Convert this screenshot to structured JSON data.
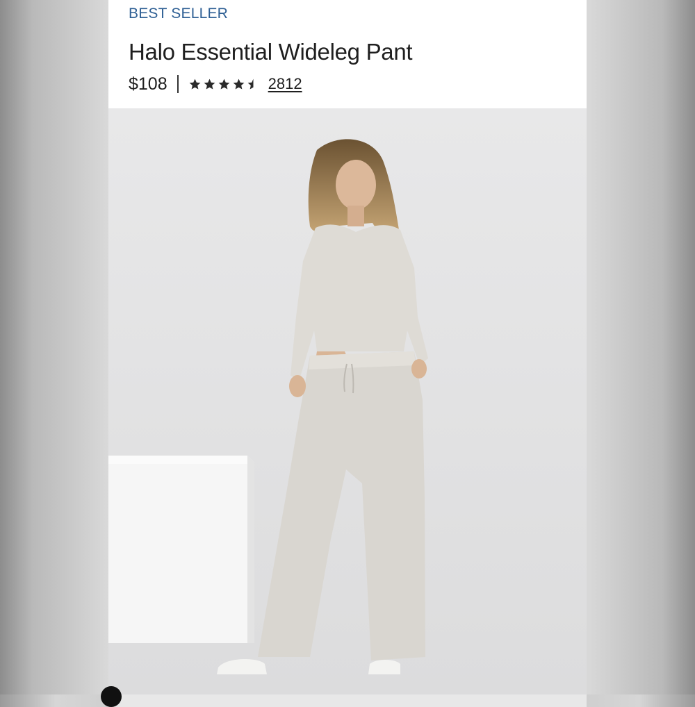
{
  "product": {
    "badge": "BEST SELLER",
    "title": "Halo Essential Wideleg Pant",
    "price": "$108",
    "rating": 4.5,
    "review_count": "2812"
  },
  "image": {
    "alt_icon": "product-photo"
  },
  "colors": {
    "badge": "#2e5f94",
    "text": "#1f1f1f",
    "garment": "#d9d6d0"
  }
}
